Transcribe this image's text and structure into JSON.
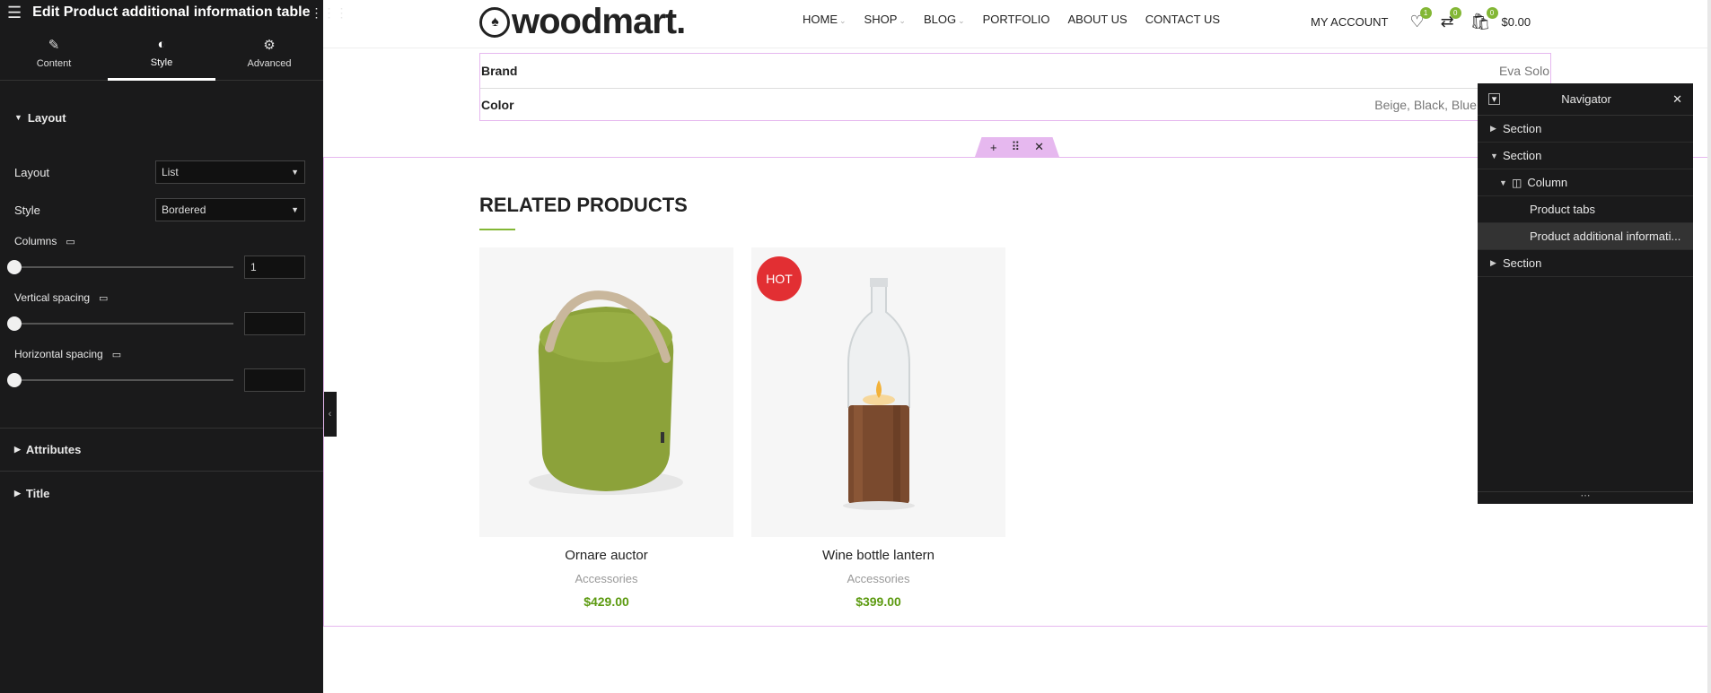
{
  "editor": {
    "title": "Edit Product additional information table",
    "tabs": [
      {
        "label": "Content",
        "icon": "pencil-icon"
      },
      {
        "label": "Style",
        "icon": "contrast-icon"
      },
      {
        "label": "Advanced",
        "icon": "gear-icon"
      }
    ],
    "layout_section": {
      "heading": "Layout",
      "layout_label": "Layout",
      "layout_value": "List",
      "style_label": "Style",
      "style_value": "Bordered",
      "columns_label": "Columns",
      "columns_value": "1",
      "columns_fraction": 0.0,
      "vspacing_label": "Vertical spacing",
      "vspacing_value": "",
      "hspacing_label": "Horizontal spacing",
      "hspacing_value": ""
    },
    "attributes_heading": "Attributes",
    "title_heading": "Title"
  },
  "site": {
    "logo_text": "woodmart.",
    "nav": [
      "HOME",
      "SHOP",
      "BLOG",
      "PORTFOLIO",
      "ABOUT US",
      "CONTACT US"
    ],
    "my_account": "MY ACCOUNT",
    "wishlist_count": "1",
    "compare_count": "0",
    "cart_count": "0",
    "cart_total": "$0.00"
  },
  "info_table": {
    "rows": [
      {
        "key": "Brand",
        "value": "Eva Solo"
      },
      {
        "key": "Color",
        "value": "Beige, Black, Blue, B"
      }
    ]
  },
  "related": {
    "title": "RELATED PRODUCTS",
    "products": [
      {
        "name": "Ornare auctor",
        "category": "Accessories",
        "price": "$429.00",
        "badge": ""
      },
      {
        "name": "Wine bottle lantern",
        "category": "Accessories",
        "price": "$399.00",
        "badge": "HOT"
      }
    ]
  },
  "navigator": {
    "title": "Navigator",
    "items": [
      {
        "label": "Section",
        "depth": 0,
        "state": "collapsed"
      },
      {
        "label": "Section",
        "depth": 0,
        "state": "expanded"
      },
      {
        "label": "Column",
        "depth": 1,
        "state": "expanded"
      },
      {
        "label": "Product tabs",
        "depth": 2,
        "state": "leaf"
      },
      {
        "label": "Product additional informati...",
        "depth": 2,
        "state": "leaf-selected"
      },
      {
        "label": "Section",
        "depth": 0,
        "state": "collapsed"
      }
    ]
  },
  "colors": {
    "panel_bg": "#1a1a1b",
    "accent_green": "#83b735",
    "price_green": "#5c9a10",
    "hot_red": "#e22f33",
    "edit_outline": "#e6b8ef"
  }
}
